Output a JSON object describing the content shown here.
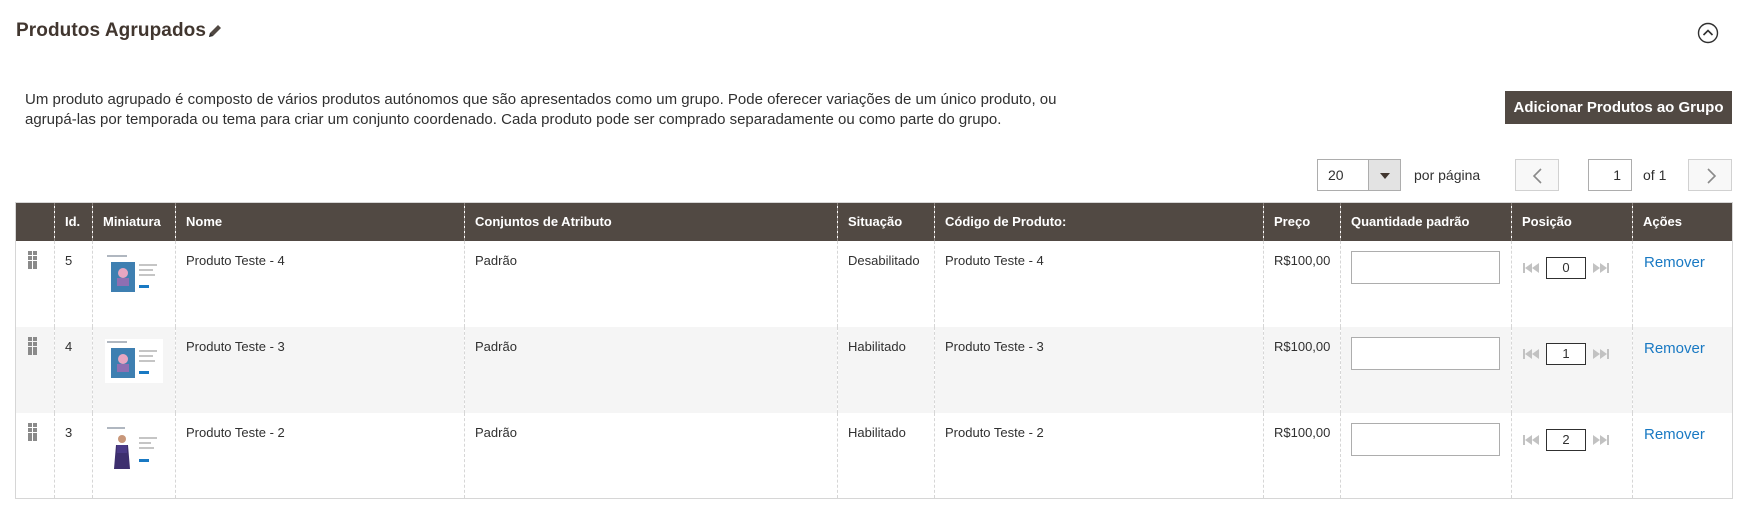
{
  "section": {
    "title": "Produtos Agrupados",
    "description_line1": "Um produto agrupado é composto de vários produtos autónomos que são apresentados como um grupo. Pode oferecer variações de um único produto, ou",
    "description_line2": "agrupá-las por temporada ou tema para criar um conjunto coordenado. Cada produto pode ser comprado separadamente ou como parte do grupo.",
    "add_button_label": "Adicionar Produtos ao Grupo"
  },
  "pager": {
    "per_page_value": "20",
    "per_page_label": "por página",
    "current_page": "1",
    "total_label": "of 1"
  },
  "grid": {
    "columns": [
      "Id.",
      "Miniatura",
      "Nome",
      "Conjuntos de Atributo",
      "Situação",
      "Código de Produto:",
      "Preço",
      "Quantidade padrão",
      "Posição",
      "Ações"
    ],
    "rows": [
      {
        "id": "5",
        "name": "Produto Teste - 4",
        "attribute_set": "Padrão",
        "status": "Desabilitado",
        "sku": "Produto Teste - 4",
        "price": "R$100,00",
        "qty": "",
        "position": "0",
        "action": "Remover"
      },
      {
        "id": "4",
        "name": "Produto Teste - 3",
        "attribute_set": "Padrão",
        "status": "Habilitado",
        "sku": "Produto Teste - 3",
        "price": "R$100,00",
        "qty": "",
        "position": "1",
        "action": "Remover"
      },
      {
        "id": "3",
        "name": "Produto Teste - 2",
        "attribute_set": "Padrão",
        "status": "Habilitado",
        "sku": "Produto Teste - 2",
        "price": "R$100,00",
        "qty": "",
        "position": "2",
        "action": "Remover"
      }
    ]
  },
  "icons": {
    "edit": "pencil-icon",
    "collapse": "chevron-up-circle-icon",
    "drag": "drag-handle-icon",
    "first": "move-first-icon",
    "last": "move-last-icon"
  },
  "colors": {
    "header_bg": "#514943",
    "link": "#1979c3",
    "row_alt": "#f5f5f5"
  }
}
